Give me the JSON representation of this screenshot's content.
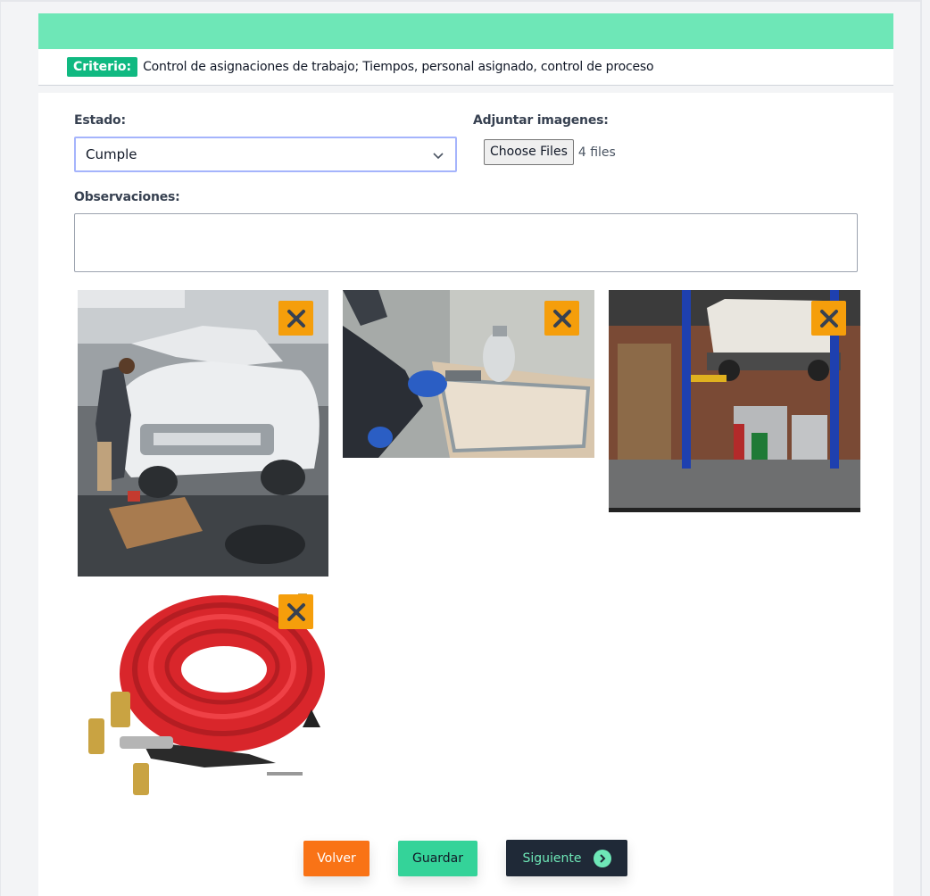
{
  "criterion": {
    "badge": "Criterio:",
    "text": "Control de asignaciones de trabajo; Tiempos, personal asignado, control de proceso"
  },
  "form": {
    "estado_label": "Estado:",
    "estado_value": "Cumple",
    "adjuntar_label": "Adjuntar imagenes:",
    "file_button": "Choose Files",
    "file_count": "4 files",
    "observaciones_label": "Observaciones:",
    "observaciones_value": ""
  },
  "images": [
    {
      "subject": "mechanic working on white car with hood open",
      "remove_icon": "close-icon"
    },
    {
      "subject": "spray painting with blue gloves",
      "remove_icon": "close-icon"
    },
    {
      "subject": "garage with car on lift",
      "remove_icon": "close-icon"
    },
    {
      "subject": "red air hose with fittings",
      "remove_icon": "close-icon"
    }
  ],
  "actions": {
    "volver": "Volver",
    "guardar": "Guardar",
    "siguiente": "Siguiente",
    "siguiente_icon": "chevron-right-circle-icon"
  },
  "colors": {
    "header": "#6ee7b7",
    "badge": "#10b981",
    "remove": "#f59e0b",
    "volver": "#f97316",
    "guardar": "#34d399",
    "siguiente": "#1f2937"
  }
}
